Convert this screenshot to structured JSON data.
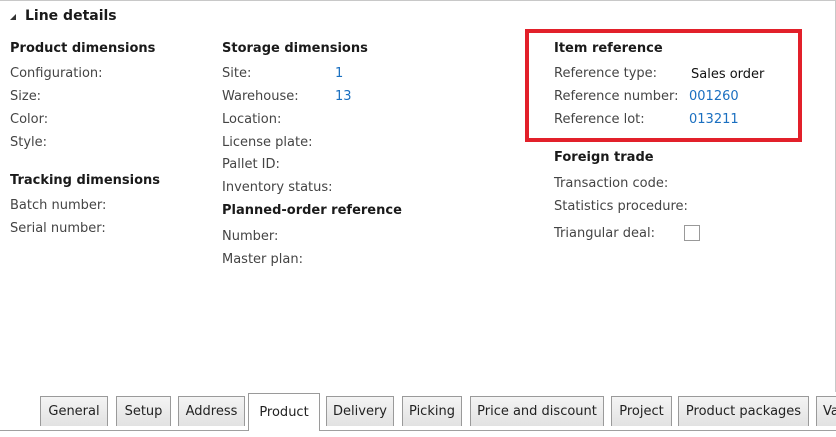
{
  "section": {
    "title": "Line details"
  },
  "product_dimensions": {
    "title": "Product dimensions",
    "fields": [
      {
        "label": "Configuration:",
        "value": ""
      },
      {
        "label": "Size:",
        "value": ""
      },
      {
        "label": "Color:",
        "value": ""
      },
      {
        "label": "Style:",
        "value": ""
      }
    ]
  },
  "tracking_dimensions": {
    "title": "Tracking dimensions",
    "fields": [
      {
        "label": "Batch number:",
        "value": ""
      },
      {
        "label": "Serial number:",
        "value": ""
      }
    ]
  },
  "storage_dimensions": {
    "title": "Storage dimensions",
    "fields": [
      {
        "label": "Site:",
        "value": "1"
      },
      {
        "label": "Warehouse:",
        "value": "13"
      },
      {
        "label": "Location:",
        "value": ""
      },
      {
        "label": "License plate:",
        "value": ""
      },
      {
        "label": "Pallet ID:",
        "value": ""
      },
      {
        "label": "Inventory status:",
        "value": ""
      }
    ]
  },
  "planned_order_reference": {
    "title": "Planned-order reference",
    "fields": [
      {
        "label": "Number:",
        "value": ""
      },
      {
        "label": "Master plan:",
        "value": ""
      }
    ]
  },
  "item_reference": {
    "title": "Item reference",
    "fields": [
      {
        "label": "Reference type:",
        "value": "Sales order"
      },
      {
        "label": "Reference number:",
        "value": "001260"
      },
      {
        "label": "Reference lot:",
        "value": "013211"
      }
    ]
  },
  "foreign_trade": {
    "title": "Foreign trade",
    "fields": [
      {
        "label": "Transaction code:",
        "value": ""
      },
      {
        "label": "Statistics procedure:",
        "value": ""
      },
      {
        "label": "Triangular deal:",
        "value": false
      }
    ]
  },
  "tabs": [
    {
      "label": "General",
      "active": false
    },
    {
      "label": "Setup",
      "active": false
    },
    {
      "label": "Address",
      "active": false
    },
    {
      "label": "Product",
      "active": true
    },
    {
      "label": "Delivery",
      "active": false
    },
    {
      "label": "Picking",
      "active": false
    },
    {
      "label": "Price and discount",
      "active": false
    },
    {
      "label": "Project",
      "active": false
    },
    {
      "label": "Product packages",
      "active": false
    },
    {
      "label": "Va",
      "active": false
    }
  ],
  "colors": {
    "link_value": "#1a6fc0",
    "highlight_border": "#e2202a"
  }
}
